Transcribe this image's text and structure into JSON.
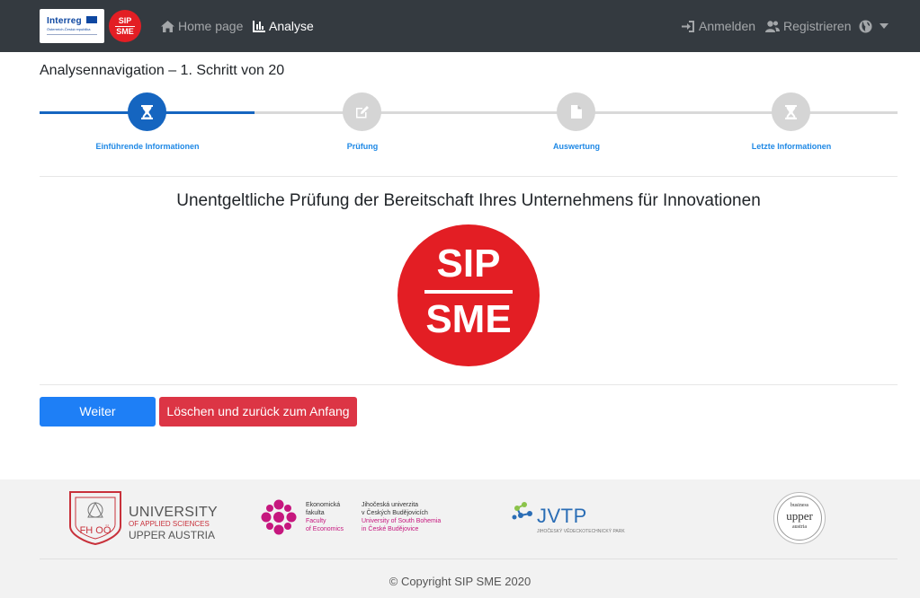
{
  "colors": {
    "navbar_bg": "#343a40",
    "step_active": "#1565c0",
    "step_label": "#1e88e5",
    "step_inactive": "#d5d5d5",
    "primary_button": "#1e7ff6",
    "danger_button": "#dc3545",
    "brand_red": "#e31e24",
    "footer_bg": "#f2f2f2"
  },
  "navbar": {
    "brand_interreg": {
      "name": "Interreg",
      "subtitle": "Österreich-Česká republika",
      "icon": "eu-flag-icon"
    },
    "brand_sip": {
      "line1": "SIP",
      "line2": "SME"
    },
    "home": {
      "label": "Home page",
      "icon": "home-icon"
    },
    "analyse": {
      "label": "Analyse",
      "icon": "bar-chart-icon"
    },
    "login": {
      "label": "Anmelden",
      "icon": "sign-in-icon"
    },
    "register": {
      "label": "Registrieren",
      "icon": "users-icon"
    },
    "language": {
      "icon": "globe-icon",
      "caret_icon": "caret-down-icon"
    }
  },
  "analysis": {
    "heading": "Analysennavigation – 1. Schritt von 20",
    "steps": [
      {
        "label": "Einführende Informationen",
        "icon": "hourglass-icon",
        "state": "current"
      },
      {
        "label": "Prüfung",
        "icon": "edit-icon",
        "state": "pending"
      },
      {
        "label": "Auswertung",
        "icon": "file-icon",
        "state": "pending"
      },
      {
        "label": "Letzte Informationen",
        "icon": "hourglass-icon",
        "state": "pending"
      }
    ]
  },
  "main": {
    "title": "Unentgeltliche Prüfung der Bereitschaft Ihres Unternehmens für Innovationen",
    "logo": {
      "line1": "SIP",
      "line2": "SME"
    }
  },
  "buttons": {
    "next": "Weiter",
    "reset": "Löschen und zurück zum Anfang"
  },
  "footer": {
    "fhooe": {
      "mark": "FH OÖ",
      "line1": "UNIVERSITY",
      "line2": "OF APPLIED SCIENCES",
      "line3": "UPPER AUSTRIA"
    },
    "ef": {
      "col1": [
        "Ekonomická",
        "fakulta",
        "Faculty",
        "of Economics"
      ],
      "col2": [
        "Jihočeská univerzita",
        "v Českých Budějovicích",
        "University of South Bohemia",
        "in České Budějovice"
      ]
    },
    "jvtp": {
      "name": "JVTP",
      "subtitle": "JIHOČESKÝ VĚDECKOTECHNICKÝ PARK"
    },
    "bua": {
      "line1": "business",
      "line2": "upper",
      "line3": "austria"
    },
    "copyright": "© Copyright SIP SME 2020"
  }
}
